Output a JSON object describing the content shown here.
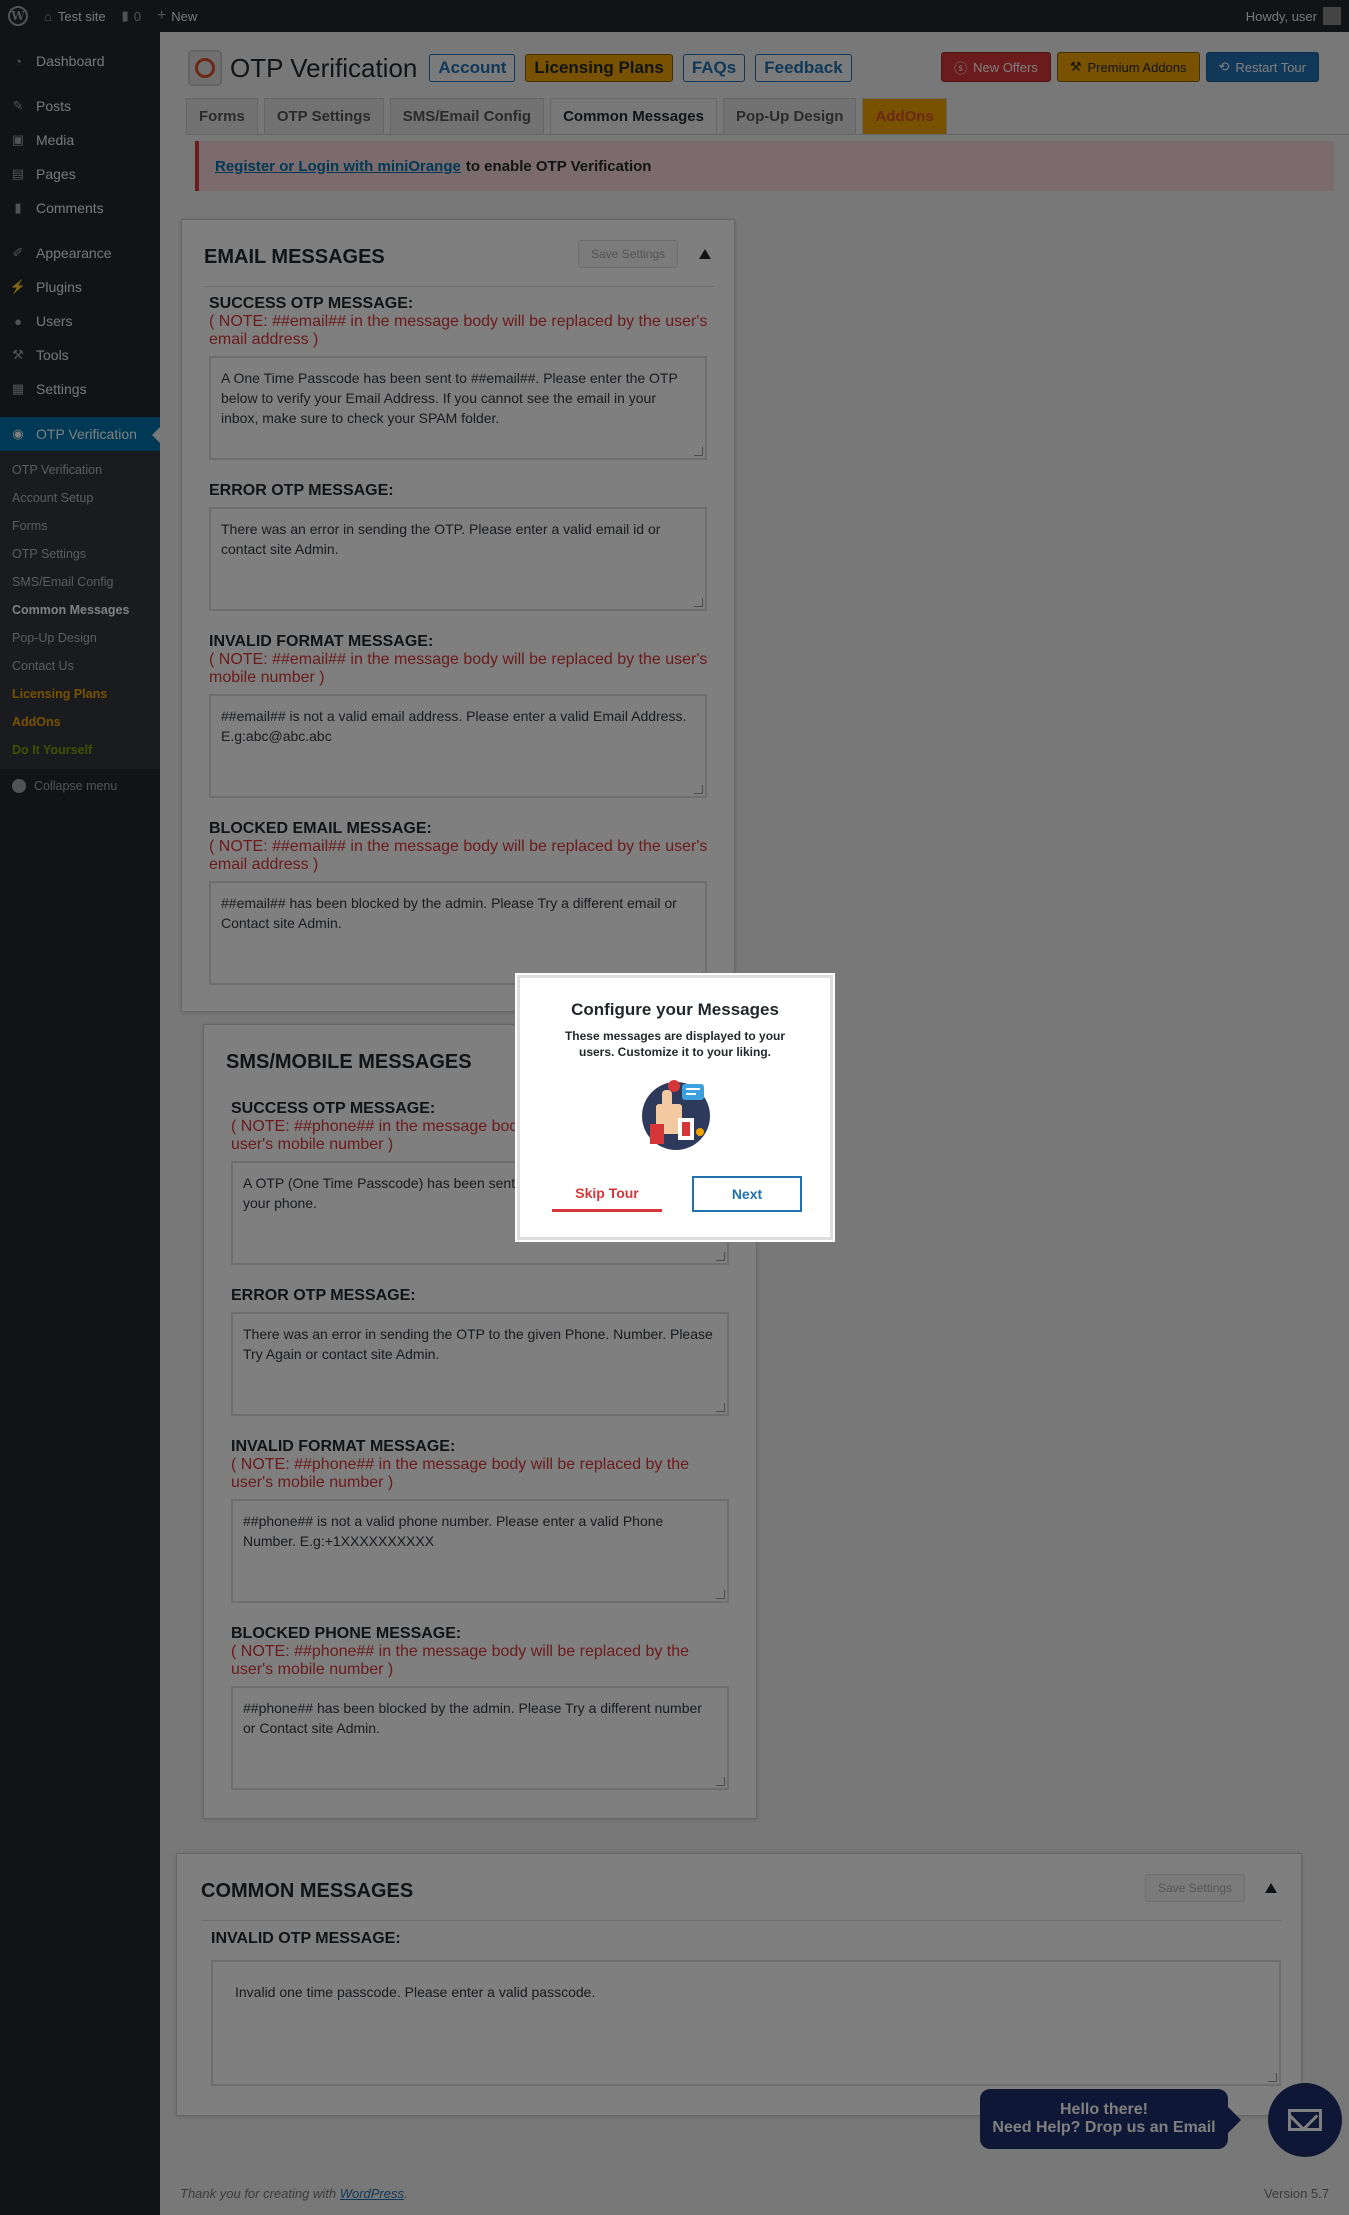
{
  "adminbar": {
    "site_name": "Test site",
    "comments_count": "0",
    "new_label": "New",
    "howdy": "Howdy, user"
  },
  "sidebar": {
    "items_top": [
      {
        "label": "Dashboard",
        "icon": "dashboard-icon"
      },
      {
        "label": "Posts",
        "icon": "pin-icon"
      },
      {
        "label": "Media",
        "icon": "media-icon"
      },
      {
        "label": "Pages",
        "icon": "pages-icon"
      },
      {
        "label": "Comments",
        "icon": "comments-icon"
      },
      {
        "label": "Appearance",
        "icon": "brush-icon"
      },
      {
        "label": "Plugins",
        "icon": "plugin-icon"
      },
      {
        "label": "Users",
        "icon": "users-icon"
      },
      {
        "label": "Tools",
        "icon": "wrench-icon"
      },
      {
        "label": "Settings",
        "icon": "settings-icon"
      }
    ],
    "active_label": "OTP Verification",
    "submenu": [
      "OTP Verification",
      "Account Setup",
      "Forms",
      "OTP Settings",
      "SMS/Email Config",
      "Common Messages",
      "Pop-Up Design",
      "Contact Us",
      "Licensing Plans",
      "AddOns",
      "Do It Yourself"
    ],
    "collapse": "Collapse menu"
  },
  "header": {
    "title": "OTP Verification",
    "buttons": [
      "Account",
      "Licensing Plans",
      "FAQs",
      "Feedback"
    ],
    "right_buttons": [
      "New Offers",
      "Premium Addons",
      "Restart Tour"
    ]
  },
  "tabs": [
    "Forms",
    "OTP Settings",
    "SMS/Email Config",
    "Common Messages",
    "Pop-Up Design",
    "AddOns"
  ],
  "notice": {
    "link": "Register or Login with miniOrange",
    "text": "to enable OTP Verification"
  },
  "email_panel": {
    "title": "EMAIL MESSAGES",
    "save": "Save Settings",
    "fields": [
      {
        "label": "SUCCESS OTP MESSAGE:",
        "note1": "( NOTE: ##email## in the message body will be replaced by the user's",
        "note2": "email address )",
        "value": "A One Time Passcode has been sent to ##email##. Please enter the OTP below to verify your Email Address. If you cannot see the email in your inbox, make sure to check your SPAM folder."
      },
      {
        "label": "ERROR OTP MESSAGE:",
        "value": "There was an error in sending the OTP. Please enter a valid email id or contact site Admin."
      },
      {
        "label": "INVALID FORMAT MESSAGE:",
        "note1": "( NOTE: ##email## in the message body will be replaced by the user's",
        "note2": "mobile number )",
        "value": "##email## is not a valid email address. Please enter a valid Email Address. E.g:abc@abc.abc"
      },
      {
        "label": "BLOCKED EMAIL MESSAGE:",
        "note1": "( NOTE: ##email## in the message body will be replaced by the user's",
        "note2": "email address )",
        "value": "##email## has been blocked by the admin. Please Try a different email or Contact site Admin."
      }
    ]
  },
  "sms_panel": {
    "title": "SMS/MOBILE MESSAGES",
    "fields": [
      {
        "label": "SUCCESS OTP MESSAGE:",
        "note1": "( NOTE: ##phone## in the message bod",
        "note2": "user's mobile number )",
        "value": "A OTP (One Time Passcode) has been sent OTP in the field below to verify your phone."
      },
      {
        "label": "ERROR OTP MESSAGE:",
        "value": "There was an error in sending the OTP to the given Phone. Number. Please Try Again or contact site Admin."
      },
      {
        "label": "INVALID FORMAT MESSAGE:",
        "note1": "( NOTE: ##phone## in the message body will be replaced by the",
        "note2": "user's mobile number )",
        "value": "##phone## is not a valid phone number. Please enter a valid Phone Number. E.g:+1XXXXXXXXXX"
      },
      {
        "label": "BLOCKED PHONE MESSAGE:",
        "note1": "( NOTE: ##phone## in the message body will be replaced by the",
        "note2": "user's mobile number )",
        "value": "##phone## has been blocked by the admin. Please Try a different number or Contact site Admin."
      }
    ]
  },
  "common_panel": {
    "title": "COMMON MESSAGES",
    "save": "Save Settings",
    "field_label": "INVALID OTP MESSAGE:",
    "field_value": "Invalid one time passcode. Please enter a valid passcode."
  },
  "tour": {
    "title": "Configure your Messages",
    "desc": "These messages are displayed to your users. Customize it to your liking.",
    "skip": "Skip Tour",
    "next": "Next"
  },
  "footer": {
    "text": "Thank you for creating with",
    "link": "WordPress",
    "version": "Version 5.7"
  },
  "help": {
    "line1": "Hello there!",
    "line2": "Need Help? Drop us an Email"
  }
}
